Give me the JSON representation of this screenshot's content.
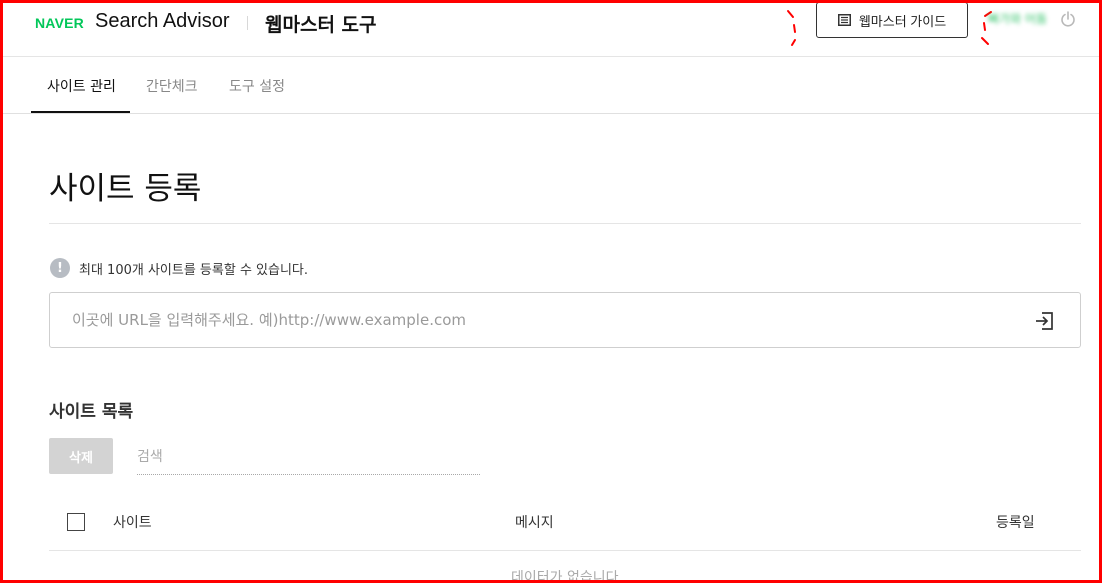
{
  "header": {
    "logo": "NAVER",
    "product": "Search Advisor",
    "tool_title": "웹마스터 도구",
    "guide_button": "웹마스터 가이드",
    "user_name": "빠가와 어둠",
    "icons": {
      "guide": "book-icon",
      "logout": "power-icon"
    }
  },
  "tabs": [
    {
      "label": "사이트 관리",
      "active": true
    },
    {
      "label": "간단체크",
      "active": false
    },
    {
      "label": "도구 설정",
      "active": false
    }
  ],
  "main": {
    "page_title": "사이트 등록",
    "notice": "최대 100개 사이트를 등록할 수 있습니다.",
    "notice_icon_glyph": "!",
    "url_input": {
      "value": "",
      "placeholder": "이곳에 URL을 입력해주세요. 예)http://www.example.com"
    },
    "site_list": {
      "title": "사이트 목록",
      "delete_button": "삭제",
      "search": {
        "value": "",
        "placeholder": "검색"
      },
      "columns": [
        "사이트",
        "메시지",
        "등록일"
      ],
      "empty_text": "데이터가 없습니다"
    }
  },
  "colors": {
    "brand": "#03c75a",
    "annotation": "#ff0000",
    "disabled_button": "#d3d3d3"
  }
}
